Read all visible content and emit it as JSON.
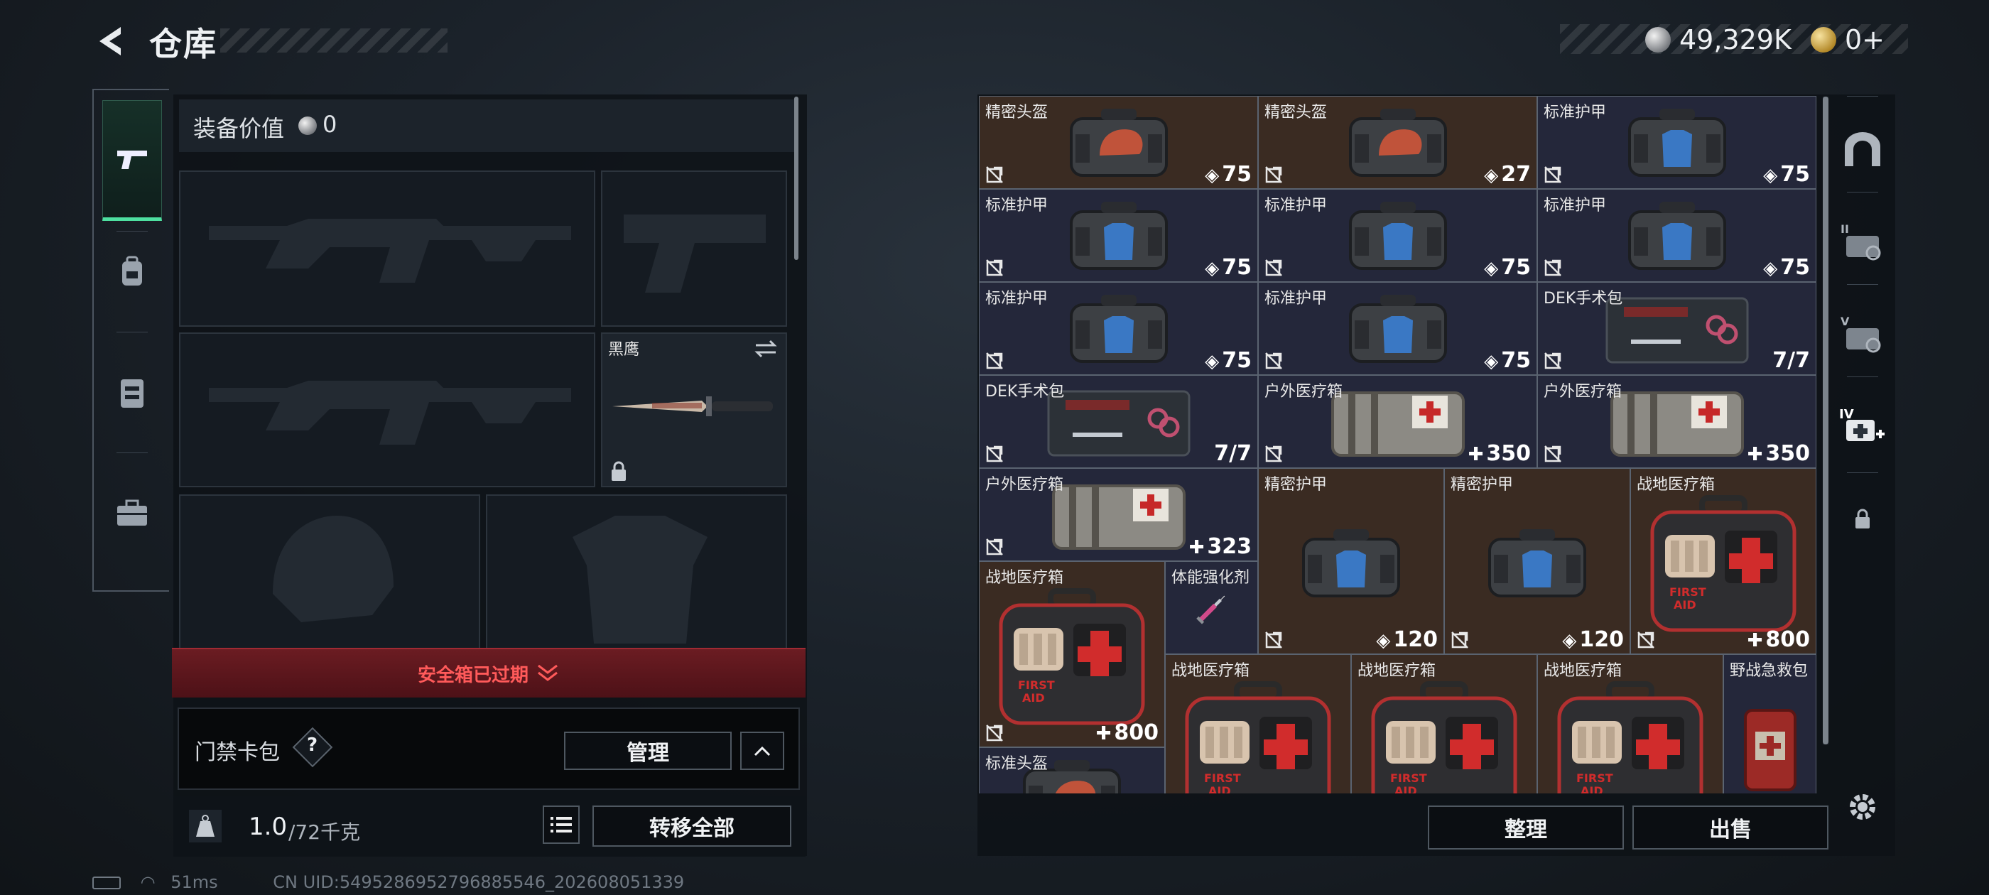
{
  "header": {
    "title": "仓库",
    "back_icon": "back-arrow-icon"
  },
  "currency": {
    "silver_value": "49,329K",
    "gold_value": "0+"
  },
  "left_tabs": [
    {
      "icon": "pistol-icon",
      "active": true
    },
    {
      "icon": "backpack-icon",
      "active": false
    },
    {
      "icon": "vest-rig-icon",
      "active": false
    },
    {
      "icon": "briefcase-icon",
      "active": false
    }
  ],
  "equipment": {
    "value_label": "装备价值",
    "value": "0",
    "melee_name": "黑鹰",
    "safe_box_banner": "安全箱已过期",
    "keycard_label": "门禁卡包",
    "help_label": "?",
    "manage_label": "管理",
    "capacity_used": "1.0",
    "capacity_total": "/72千克",
    "transfer_all_label": "转移全部"
  },
  "grid_items": [
    {
      "name": "精密头盔",
      "value": "75",
      "kind": "durability",
      "art": "helmet-bag",
      "bg": "brown"
    },
    {
      "name": "精密头盔",
      "value": "27",
      "kind": "durability",
      "art": "helmet-bag",
      "bg": "brown"
    },
    {
      "name": "标准护甲",
      "value": "75",
      "kind": "durability",
      "art": "armor-bag",
      "bg": "blue"
    },
    {
      "name": "标准护甲",
      "value": "75",
      "kind": "durability",
      "art": "armor-bag",
      "bg": "blue"
    },
    {
      "name": "标准护甲",
      "value": "75",
      "kind": "durability",
      "art": "armor-bag",
      "bg": "blue"
    },
    {
      "name": "标准护甲",
      "value": "75",
      "kind": "durability",
      "art": "armor-bag",
      "bg": "blue"
    },
    {
      "name": "标准护甲",
      "value": "75",
      "kind": "durability",
      "art": "armor-bag",
      "bg": "blue"
    },
    {
      "name": "标准护甲",
      "value": "75",
      "kind": "durability",
      "art": "armor-bag",
      "bg": "blue"
    },
    {
      "name": "DEK手术包",
      "value": "7/7",
      "kind": "uses",
      "art": "surgery-kit",
      "bg": "blue"
    },
    {
      "name": "DEK手术包",
      "value": "7/7",
      "kind": "uses",
      "art": "surgery-kit",
      "bg": "blue"
    },
    {
      "name": "户外医疗箱",
      "value": "350",
      "kind": "heal",
      "art": "outdoor-medkit",
      "bg": "blue"
    },
    {
      "name": "户外医疗箱",
      "value": "350",
      "kind": "heal",
      "art": "outdoor-medkit",
      "bg": "blue"
    },
    {
      "name": "户外医疗箱",
      "value": "323",
      "kind": "heal",
      "art": "outdoor-medkit",
      "bg": "blue"
    },
    {
      "name": "精密护甲",
      "value": "120",
      "kind": "durability",
      "art": "armor-bag",
      "bg": "brown"
    },
    {
      "name": "精密护甲",
      "value": "120",
      "kind": "durability",
      "art": "armor-bag",
      "bg": "brown"
    },
    {
      "name": "战地医疗箱",
      "value": "800",
      "kind": "heal",
      "art": "first-aid-case",
      "bg": "brown"
    },
    {
      "name": "战地医疗箱",
      "value": "800",
      "kind": "heal",
      "art": "first-aid-case",
      "bg": "brown"
    },
    {
      "name": "体能强化剂",
      "value": "",
      "kind": "none",
      "art": "syringe",
      "bg": "blue"
    },
    {
      "name": "战地医疗箱",
      "value": "",
      "kind": "none",
      "art": "first-aid-case",
      "bg": "brown"
    },
    {
      "name": "战地医疗箱",
      "value": "",
      "kind": "none",
      "art": "first-aid-case",
      "bg": "brown"
    },
    {
      "name": "战地医疗箱",
      "value": "",
      "kind": "none",
      "art": "first-aid-case",
      "bg": "brown"
    },
    {
      "name": "野战急救包",
      "value": "",
      "kind": "none",
      "art": "field-aid-pouch",
      "bg": "blue"
    },
    {
      "name": "标准头盔",
      "value": "",
      "kind": "none",
      "art": "helmet-bag",
      "bg": "blue"
    }
  ],
  "stash_buttons": {
    "sort_label": "整理",
    "sell_label": "出售"
  },
  "right_tabs": [
    {
      "icon": "stash-arch-icon",
      "label": ""
    },
    {
      "icon": "stash-ii-icon",
      "label": "II"
    },
    {
      "icon": "stash-v-icon",
      "label": "V"
    },
    {
      "icon": "stash-iv-medical-icon",
      "label": "IV"
    },
    {
      "icon": "lock-icon",
      "label": ""
    }
  ],
  "status": {
    "ping": "51ms",
    "uid": "CN UID:5495286952796885546_202608051339"
  }
}
